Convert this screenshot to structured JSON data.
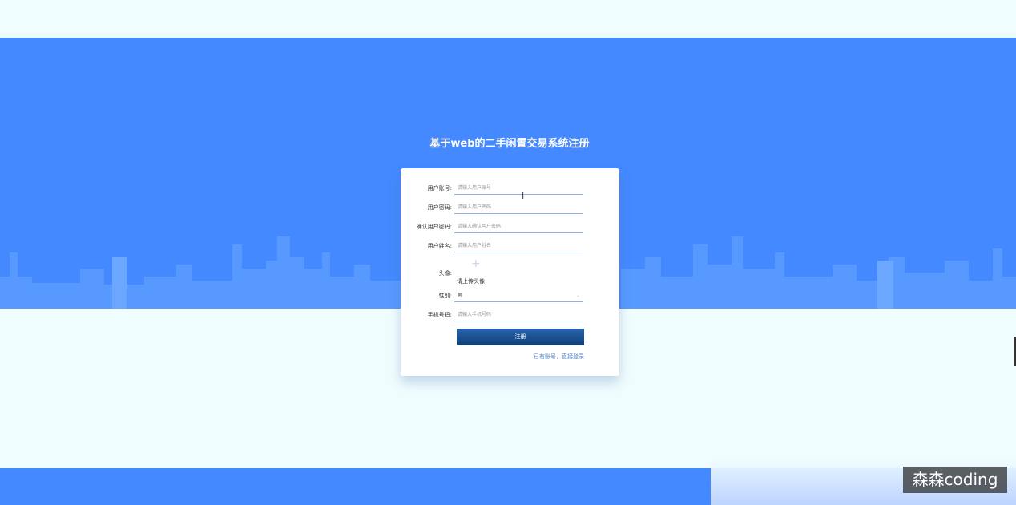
{
  "page": {
    "title": "基于web的二手闲置交易系统注册"
  },
  "form": {
    "fields": [
      {
        "label": "用户账号:",
        "placeholder": "请输入用户账号"
      },
      {
        "label": "用户密码:",
        "placeholder": "请输入用户密码"
      },
      {
        "label": "确认用户密码:",
        "placeholder": "请输入确认用户密码"
      },
      {
        "label": "用户姓名:",
        "placeholder": "请输入用户姓名"
      }
    ],
    "avatar": {
      "label": "头像:",
      "upload_hint": "请上传头像"
    },
    "gender": {
      "label": "性别:",
      "value": "男"
    },
    "phone": {
      "label": "手机号码:",
      "placeholder": "请输入手机号码"
    },
    "submit_label": "注册",
    "login_link": "已有账号，直接登录"
  },
  "watermark": "森森coding",
  "colors": {
    "primary": "#4489ff",
    "button": "#1b4f8f",
    "background": "#f0fdff"
  }
}
